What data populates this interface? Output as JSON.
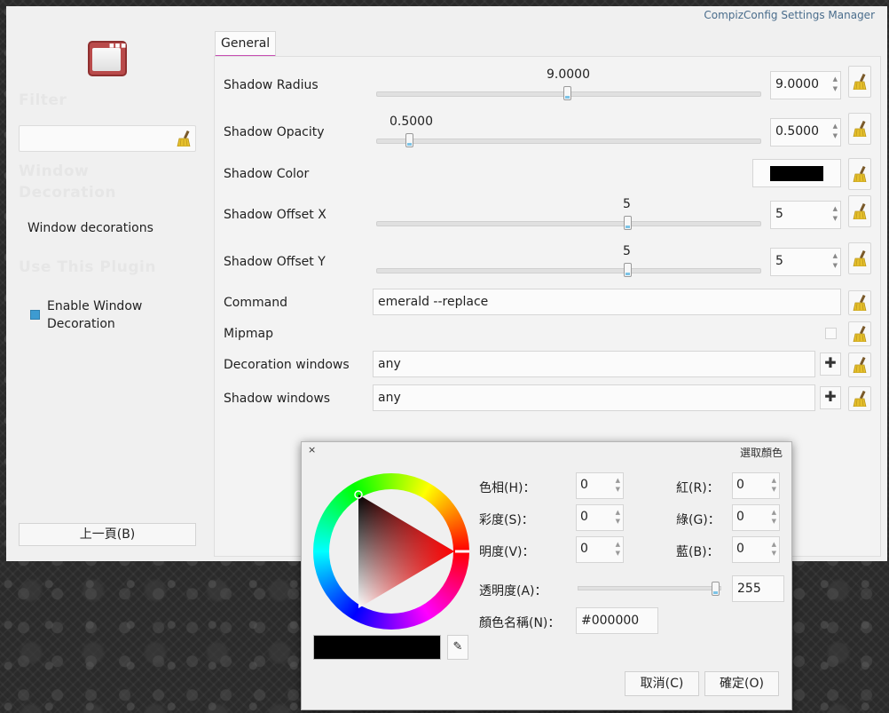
{
  "window": {
    "title": "CompizConfig Settings Manager"
  },
  "sidebar": {
    "filter_title": "Filter",
    "category_title_1": "Window",
    "category_title_2": "Decoration",
    "link_label": "Window decorations",
    "use_plugin_title": "Use This Plugin",
    "enable_label_1": "Enable Window",
    "enable_label_2": "Decoration",
    "enable_checked": true,
    "back_label": "上一頁(B)"
  },
  "tab": {
    "label": "General"
  },
  "settings": {
    "shadow_radius": {
      "label": "Shadow Radius",
      "value": "9.0000",
      "slider_fraction": 0.5
    },
    "shadow_opacity": {
      "label": "Shadow Opacity",
      "value": "0.5000",
      "slider_fraction": 0.08
    },
    "shadow_color": {
      "label": "Shadow Color",
      "color": "#000000"
    },
    "shadow_offset_x": {
      "label": "Shadow Offset X",
      "value": "5",
      "slider_fraction": 0.66
    },
    "shadow_offset_y": {
      "label": "Shadow Offset Y",
      "value": "5",
      "slider_fraction": 0.66
    },
    "command": {
      "label": "Command",
      "value": "emerald --replace"
    },
    "mipmap": {
      "label": "Mipmap",
      "checked": false
    },
    "decoration_windows": {
      "label": "Decoration windows",
      "value": "any"
    },
    "shadow_windows": {
      "label": "Shadow windows",
      "value": "any"
    }
  },
  "dialog": {
    "title": "選取顏色",
    "close": "×",
    "hue_label": "色相(H)：",
    "hue": "0",
    "sat_label": "彩度(S)：",
    "sat": "0",
    "val_label": "明度(V)：",
    "val": "0",
    "red_label": "紅(R)：",
    "red": "0",
    "green_label": "綠(G)：",
    "green": "0",
    "blue_label": "藍(B)：",
    "blue": "0",
    "alpha_label": "透明度(A)：",
    "alpha": "255",
    "alpha_fraction": 1.0,
    "name_label": "顏色名稱(N)：",
    "name": "#000000",
    "cancel": "取消(C)",
    "ok": "確定(O)",
    "current_color": "#000000"
  },
  "icons": [
    "app-settings-icon",
    "broom-icon",
    "plus-icon",
    "eyedropper-icon",
    "spin-arrows-icon"
  ]
}
